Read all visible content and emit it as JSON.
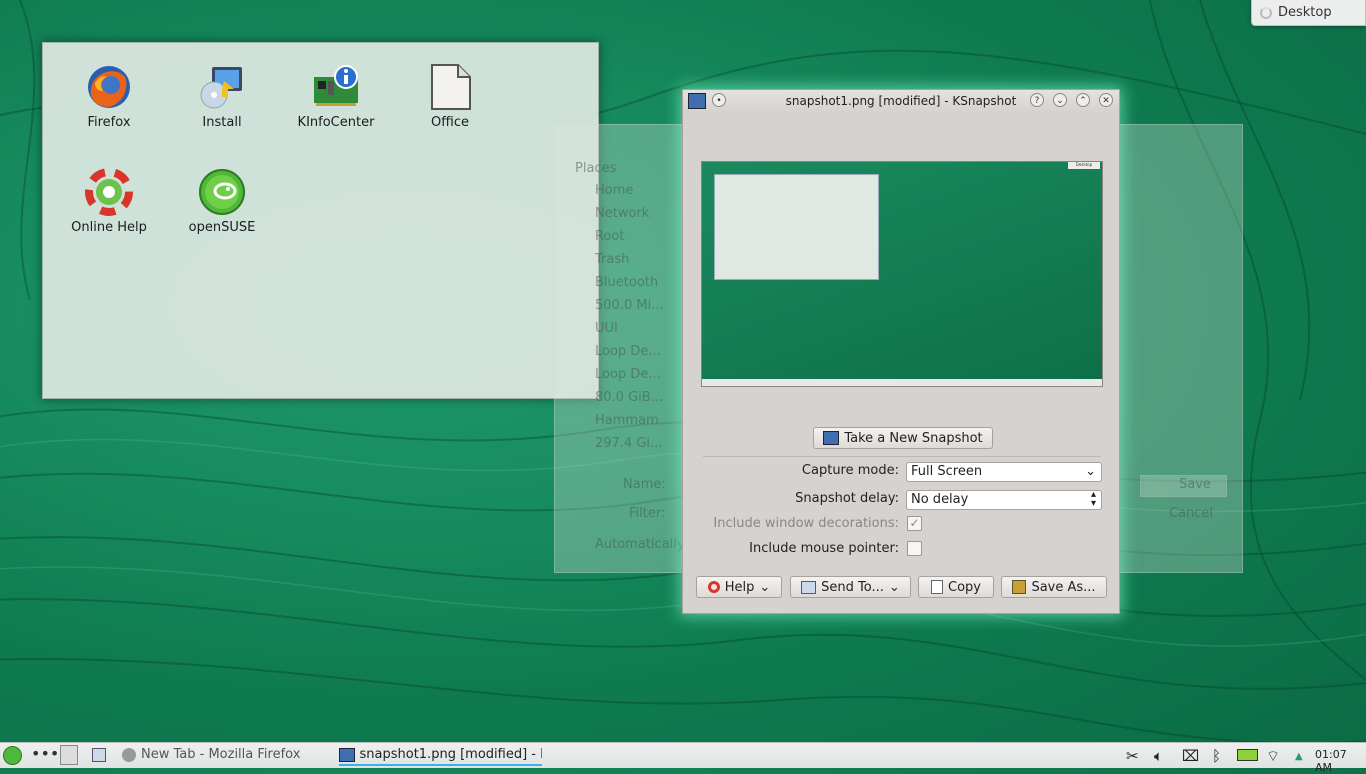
{
  "desktop": {
    "toolbox_label": "Desktop",
    "icons": [
      {
        "label": "Firefox",
        "icon": "firefox-icon"
      },
      {
        "label": "Install",
        "icon": "install-icon"
      },
      {
        "label": "KInfoCenter",
        "icon": "kinfocenter-icon"
      },
      {
        "label": "Office",
        "icon": "office-icon"
      },
      {
        "label": "Online Help",
        "icon": "online-help-icon"
      },
      {
        "label": "openSUSE",
        "icon": "opensuse-icon"
      }
    ]
  },
  "background_dialog": {
    "places_header": "Places",
    "places": [
      "Home",
      "Network",
      "Root",
      "Trash",
      "Bluetooth",
      "500.0 Mi...",
      "UUI",
      "Loop De...",
      "Loop De...",
      "80.0 GiB...",
      "Hammam",
      "297.4 Gi..."
    ],
    "name_label": "Name:",
    "filter_label": "Filter:",
    "auto_label": "Automatically",
    "save_label": "Save",
    "cancel_label": "Cancel"
  },
  "ksnapshot": {
    "title": "snapshot1.png [modified] - KSnapshot",
    "new_snapshot_button": "Take a New Snapshot",
    "capture_mode_label": "Capture mode:",
    "capture_mode_value": "Full Screen",
    "delay_label": "Snapshot delay:",
    "delay_value": "No delay",
    "include_decorations_label": "Include window decorations:",
    "include_decorations_checked": true,
    "include_pointer_label": "Include mouse pointer:",
    "include_pointer_checked": false,
    "help_button": "Help",
    "send_to_button": "Send To...",
    "copy_button": "Copy",
    "save_as_button": "Save As...",
    "preview_desktop_label": "Desktop"
  },
  "taskbar": {
    "tasks": [
      {
        "label": "New Tab - Mozilla Firefox",
        "active": false
      },
      {
        "label": "snapshot1.png [modified] - K",
        "active": true
      }
    ],
    "clock": "01:07 AM"
  },
  "colors": {
    "accent": "#1a8a5f",
    "window_bg": "#d6d2cf",
    "glow": "#8cffd2"
  }
}
